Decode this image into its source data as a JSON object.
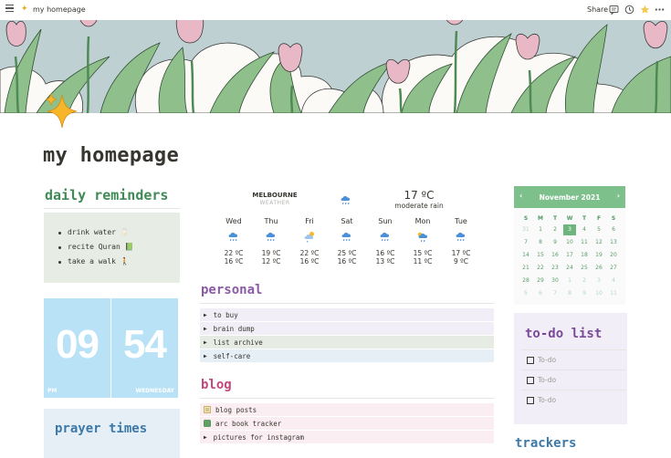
{
  "topbar": {
    "page_title": "my homepage",
    "share_label": "Share",
    "icons": [
      "menu-icon",
      "sparkle-icon",
      "comment-icon",
      "history-icon",
      "favorite-star-icon",
      "more-icon"
    ]
  },
  "page": {
    "title": "my homepage"
  },
  "daily_reminders": {
    "heading": "daily reminders",
    "items": [
      "drink water 🥛",
      "recite Quran 📗",
      "take a walk 🚶"
    ]
  },
  "clock": {
    "hour": "09",
    "minute": "54",
    "period": "PM",
    "weekday": "WEDNESDAY"
  },
  "prayer": {
    "heading": "prayer times"
  },
  "weather": {
    "city": "MELBOURNE",
    "label": "WEATHER",
    "current_temp": "17 ºC",
    "current_desc": "moderate rain",
    "days": [
      {
        "name": "Wed",
        "icon": "rain",
        "hi": "22 ºC",
        "lo": "16 ºC"
      },
      {
        "name": "Thu",
        "icon": "rain",
        "hi": "19 ºC",
        "lo": "12 ºC"
      },
      {
        "name": "Fri",
        "icon": "sun-cloud",
        "hi": "22 ºC",
        "lo": "16 ºC"
      },
      {
        "name": "Sat",
        "icon": "rain",
        "hi": "25 ºC",
        "lo": "16 ºC"
      },
      {
        "name": "Sun",
        "icon": "rain",
        "hi": "16 ºC",
        "lo": "13 ºC"
      },
      {
        "name": "Mon",
        "icon": "sun-rain",
        "hi": "15 ºC",
        "lo": "11 ºC"
      },
      {
        "name": "Tue",
        "icon": "rain",
        "hi": "17 ºC",
        "lo": "9 ºC"
      }
    ]
  },
  "personal": {
    "heading": "personal",
    "rows": [
      {
        "label": "to buy",
        "bg": "#f2eef7"
      },
      {
        "label": "brain dump",
        "bg": "#f2eef7"
      },
      {
        "label": "list archive",
        "bg": "#e6ece4"
      },
      {
        "label": "self-care",
        "bg": "#e6eef6"
      }
    ]
  },
  "blog": {
    "heading": "blog",
    "rows": [
      {
        "emoji": "📝",
        "label": "blog posts",
        "bg": "#fbeef2"
      },
      {
        "emoji": "📗",
        "label": "arc book tracker",
        "bg": "#fbeef2"
      },
      {
        "emoji": "▶",
        "label": "pictures for instagram",
        "bg": "#fbeef2"
      }
    ]
  },
  "calendar": {
    "month_label": "November 2021",
    "weekdays": [
      "S",
      "M",
      "T",
      "W",
      "T",
      "F",
      "S"
    ],
    "weeks": [
      [
        "31",
        "1",
        "2",
        "3",
        "4",
        "5",
        "6"
      ],
      [
        "7",
        "8",
        "9",
        "10",
        "11",
        "12",
        "13"
      ],
      [
        "14",
        "15",
        "16",
        "17",
        "18",
        "19",
        "20"
      ],
      [
        "21",
        "22",
        "23",
        "24",
        "25",
        "26",
        "27"
      ],
      [
        "28",
        "29",
        "30",
        "1",
        "2",
        "3",
        "4"
      ],
      [
        "5",
        "6",
        "7",
        "8",
        "9",
        "10",
        "11"
      ]
    ],
    "today": "3",
    "accent": "#7ec08c"
  },
  "todo": {
    "heading": "to-do list",
    "items": [
      "To-do",
      "To-do",
      "To-do"
    ]
  },
  "trackers": {
    "heading": "trackers"
  }
}
